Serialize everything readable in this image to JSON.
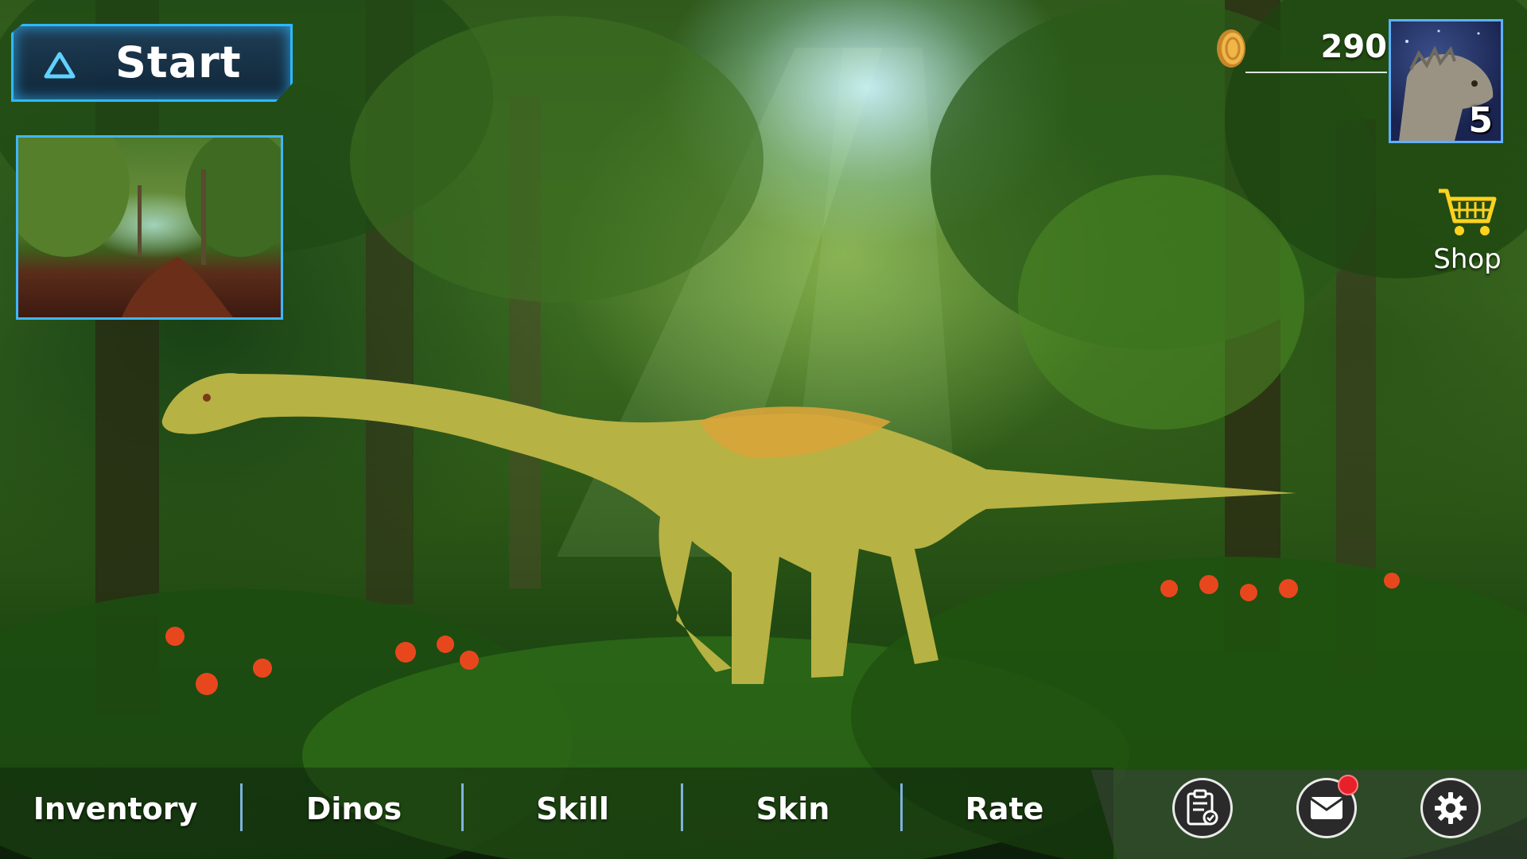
{
  "start_button": {
    "label": "Start"
  },
  "map_preview": {
    "icon": "map-thumbnail"
  },
  "currency": {
    "coins": "290",
    "icon": "coin-icon"
  },
  "player": {
    "level": "5",
    "avatar_icon": "dinosaur-avatar"
  },
  "shop": {
    "label": "Shop",
    "icon": "cart-icon"
  },
  "bottom_nav": {
    "inventory": "Inventory",
    "dinos": "Dinos",
    "skill": "Skill",
    "skin": "Skin",
    "rate": "Rate"
  },
  "actions": {
    "tasks_icon": "clipboard-icon",
    "mail_icon": "mail-icon",
    "mail_has_notification": true,
    "settings_icon": "gear-icon"
  },
  "colors": {
    "accent_blue": "#2fb8ff",
    "coin_gold": "#e2a23a",
    "shop_yellow": "#ffd21f",
    "notification_red": "#e8202a"
  }
}
